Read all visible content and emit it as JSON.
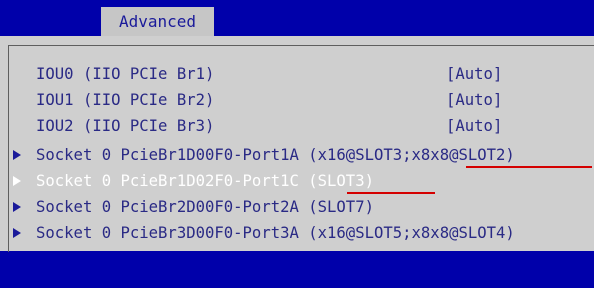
{
  "tab": {
    "label": "Advanced"
  },
  "iou_rows": [
    {
      "label": "IOU0 (IIO PCIe Br1)",
      "value": "[Auto]"
    },
    {
      "label": "IOU1 (IIO PCIe Br2)",
      "value": "[Auto]"
    },
    {
      "label": "IOU2 (IIO PCIe Br3)",
      "value": "[Auto]"
    }
  ],
  "socket_rows": [
    {
      "label": "Socket 0 PcieBr1D00F0-Port1A (x16@SLOT3;x8x8@SLOT2)"
    },
    {
      "label": "Socket 0 PcieBr1D02F0-Port1C (SLOT3)"
    },
    {
      "label": "Socket 0 PcieBr2D00F0-Port2A (SLOT7)"
    },
    {
      "label": "Socket 0 PcieBr3D00F0-Port3A (x16@SLOT5;x8x8@SLOT4)"
    }
  ],
  "colors": {
    "header_bg": "#0000aa",
    "panel_bg": "#cfcfcf",
    "text": "#2a2a85",
    "selected_text": "#ffffff",
    "annotation": "#d40000"
  }
}
